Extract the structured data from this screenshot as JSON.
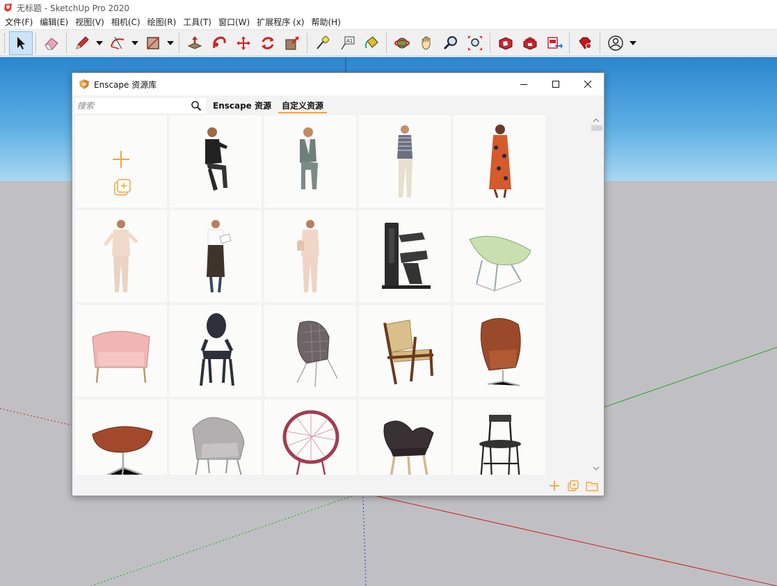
{
  "window": {
    "title": "无标题 - SketchUp Pro 2020",
    "app_icon": "sketchup-logo-icon"
  },
  "menu": [
    {
      "label": "文件(F)"
    },
    {
      "label": "编辑(E)"
    },
    {
      "label": "视图(V)"
    },
    {
      "label": "相机(C)"
    },
    {
      "label": "绘图(R)"
    },
    {
      "label": "工具(T)"
    },
    {
      "label": "窗口(W)"
    },
    {
      "label": "扩展程序 (x)"
    },
    {
      "label": "帮助(H)"
    }
  ],
  "toolbar": {
    "tools": [
      {
        "icon": "select-arrow-icon",
        "active": true
      },
      {
        "icon": "eraser-icon"
      },
      {
        "icon": "pencil-line-icon",
        "has_dropdown": true
      },
      {
        "icon": "arc-icon",
        "has_dropdown": true
      },
      {
        "icon": "rectangle-icon",
        "has_dropdown": true
      },
      {
        "icon": "push-pull-icon"
      },
      {
        "icon": "follow-me-icon"
      },
      {
        "icon": "move-icon"
      },
      {
        "icon": "rotate-icon"
      },
      {
        "icon": "scale-icon"
      },
      {
        "icon": "tape-measure-icon"
      },
      {
        "icon": "text-label-icon"
      },
      {
        "icon": "paint-bucket-icon"
      },
      {
        "icon": "orbit-icon"
      },
      {
        "icon": "pan-hand-icon"
      },
      {
        "icon": "zoom-icon"
      },
      {
        "icon": "zoom-extents-icon"
      },
      {
        "icon": "3d-warehouse-icon"
      },
      {
        "icon": "extension-warehouse-icon"
      },
      {
        "icon": "layout-send-icon"
      },
      {
        "icon": "ruby-console-icon"
      },
      {
        "icon": "user-account-icon",
        "has_dropdown": true
      }
    ]
  },
  "dialog": {
    "title": "Enscape 资源库",
    "search_placeholder": "搜索",
    "tabs": [
      {
        "label": "Enscape 资源",
        "selected": false
      },
      {
        "label": "自定义资源",
        "selected": true
      }
    ],
    "assets": [
      {
        "kind": "add-custom-asset",
        "icon": "plus-icon"
      },
      {
        "kind": "person",
        "icon": "seated-man-dark-suit-icon"
      },
      {
        "kind": "person",
        "icon": "seated-man-grey-suit-icon"
      },
      {
        "kind": "person",
        "icon": "standing-man-phone-icon"
      },
      {
        "kind": "person",
        "icon": "standing-woman-floral-dress-icon"
      },
      {
        "kind": "person",
        "icon": "standing-woman-beige-suit-icon"
      },
      {
        "kind": "person",
        "icon": "standing-woman-apron-icon"
      },
      {
        "kind": "person",
        "icon": "standing-woman-handbag-icon"
      },
      {
        "kind": "equipment",
        "icon": "gym-machine-icon"
      },
      {
        "kind": "furniture",
        "icon": "green-coconut-chair-icon"
      },
      {
        "kind": "furniture",
        "icon": "pink-armchair-icon"
      },
      {
        "kind": "furniture",
        "icon": "ghost-chair-icon"
      },
      {
        "kind": "furniture",
        "icon": "geometric-lounge-chair-icon"
      },
      {
        "kind": "furniture",
        "icon": "wooden-rope-lounge-chair-icon"
      },
      {
        "kind": "furniture",
        "icon": "brown-egg-chair-icon"
      },
      {
        "kind": "furniture",
        "icon": "brown-ottoman-icon"
      },
      {
        "kind": "furniture",
        "icon": "grey-womb-chair-icon"
      },
      {
        "kind": "furniture",
        "icon": "acapulco-chair-icon"
      },
      {
        "kind": "furniture",
        "icon": "shell-chair-icon"
      },
      {
        "kind": "furniture",
        "icon": "black-metal-chair-icon"
      }
    ],
    "footer_buttons": [
      {
        "icon": "plus-icon"
      },
      {
        "icon": "duplicate-icon"
      },
      {
        "icon": "folder-icon"
      }
    ],
    "accent_color": "#f3a43b"
  },
  "colors": {
    "sky_top": "#2a86cf",
    "sky_bottom": "#a8d8f2",
    "ground": "#c0c0c4",
    "red_axis": "#cc2222",
    "green_axis": "#2aa52a",
    "blue_axis": "#1d3fbf"
  }
}
